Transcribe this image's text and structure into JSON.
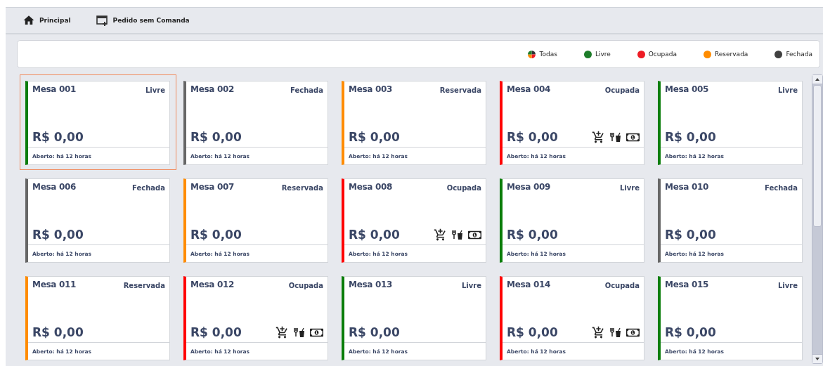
{
  "toolbar": [
    {
      "kind": "home",
      "label": "Principal"
    },
    {
      "kind": "order",
      "label": "Pedido sem Comanda"
    }
  ],
  "filters": [
    {
      "kind": "all",
      "label": "Todas"
    },
    {
      "kind": "status",
      "label": "Livre",
      "color": "#1e7d2a"
    },
    {
      "kind": "status",
      "label": "Ocupada",
      "color": "#ee1c25"
    },
    {
      "kind": "status",
      "label": "Reservada",
      "color": "#ff8c00"
    },
    {
      "kind": "status",
      "label": "Fechada",
      "color": "#404040"
    }
  ],
  "tables": [
    {
      "name": "Mesa 001",
      "status": "Livre",
      "kind": "livre",
      "color": "#0a7d0a",
      "total": "R$ 0,00",
      "opened": "Aberto: há 12 horas",
      "selected": true
    },
    {
      "name": "Mesa 002",
      "status": "Fechada",
      "kind": "fechada",
      "color": "#666666",
      "total": "R$ 0,00",
      "opened": "Aberto: há 12 horas",
      "selected": false
    },
    {
      "name": "Mesa 003",
      "status": "Reservada",
      "kind": "reservada",
      "color": "#ff8c00",
      "total": "R$ 0,00",
      "opened": "Aberto: há 12 horas",
      "selected": false
    },
    {
      "name": "Mesa 004",
      "status": "Ocupada",
      "kind": "ocupada",
      "color": "#ff0000",
      "total": "R$ 0,00",
      "opened": "Aberto: há 12 horas",
      "selected": false
    },
    {
      "name": "Mesa 005",
      "status": "Livre",
      "kind": "livre",
      "color": "#0a7d0a",
      "total": "R$ 0,00",
      "opened": "Aberto: há 12 horas",
      "selected": false
    },
    {
      "name": "Mesa 006",
      "status": "Fechada",
      "kind": "fechada",
      "color": "#666666",
      "total": "R$ 0,00",
      "opened": "Aberto: há 12 horas",
      "selected": false
    },
    {
      "name": "Mesa 007",
      "status": "Reservada",
      "kind": "reservada",
      "color": "#ff8c00",
      "total": "R$ 0,00",
      "opened": "Aberto: há 12 horas",
      "selected": false
    },
    {
      "name": "Mesa 008",
      "status": "Ocupada",
      "kind": "ocupada",
      "color": "#ff0000",
      "total": "R$ 0,00",
      "opened": "Aberto: há 12 horas",
      "selected": false
    },
    {
      "name": "Mesa 009",
      "status": "Livre",
      "kind": "livre",
      "color": "#0a7d0a",
      "total": "R$ 0,00",
      "opened": "Aberto: há 12 horas",
      "selected": false
    },
    {
      "name": "Mesa 010",
      "status": "Fechada",
      "kind": "fechada",
      "color": "#666666",
      "total": "R$ 0,00",
      "opened": "Aberto: há 12 horas",
      "selected": false
    },
    {
      "name": "Mesa 011",
      "status": "Reservada",
      "kind": "reservada",
      "color": "#ff8c00",
      "total": "R$ 0,00",
      "opened": "Aberto: há 12 horas",
      "selected": false
    },
    {
      "name": "Mesa 012",
      "status": "Ocupada",
      "kind": "ocupada",
      "color": "#ff0000",
      "total": "R$ 0,00",
      "opened": "Aberto: há 12 horas",
      "selected": false
    },
    {
      "name": "Mesa 013",
      "status": "Livre",
      "kind": "livre",
      "color": "#0a7d0a",
      "total": "R$ 0,00",
      "opened": "Aberto: há 12 horas",
      "selected": false
    },
    {
      "name": "Mesa 014",
      "status": "Ocupada",
      "kind": "ocupada",
      "color": "#ff0000",
      "total": "R$ 0,00",
      "opened": "Aberto: há 12 horas",
      "selected": false
    },
    {
      "name": "Mesa 015",
      "status": "Livre",
      "kind": "livre",
      "color": "#0a7d0a",
      "total": "R$ 0,00",
      "opened": "Aberto: há 12 horas",
      "selected": false
    }
  ]
}
